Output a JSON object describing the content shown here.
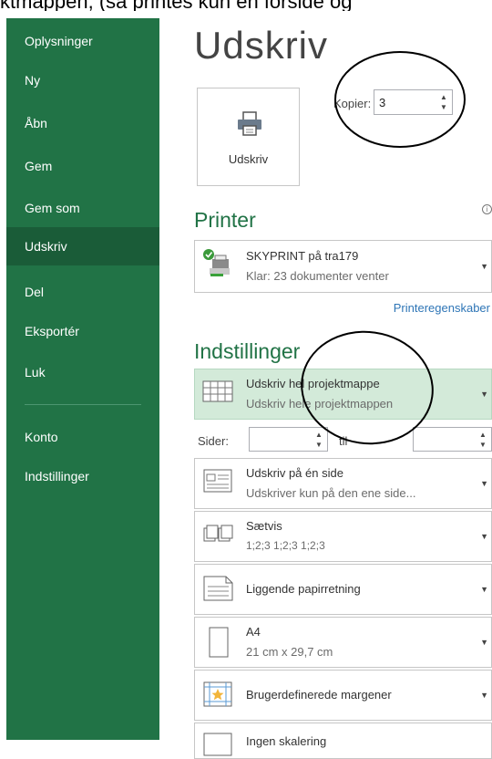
{
  "top_caption": "ktmappen, (så printes kun én forside og",
  "sidebar": {
    "items": [
      {
        "label": "Oplysninger"
      },
      {
        "label": "Ny"
      },
      {
        "label": "Åbn"
      },
      {
        "label": "Gem"
      },
      {
        "label": "Gem som"
      },
      {
        "label": "Udskriv"
      },
      {
        "label": "Del"
      },
      {
        "label": "Eksportér"
      },
      {
        "label": "Luk"
      },
      {
        "label": "Konto"
      },
      {
        "label": "Indstillinger"
      }
    ],
    "active_item": "Udskriv"
  },
  "page_title": "Udskriv",
  "print_button": {
    "label": "Udskriv"
  },
  "copies": {
    "label": "Kopier:",
    "value": "3"
  },
  "printer": {
    "heading": "Printer",
    "name": "SKYPRINT på tra179",
    "status": "Klar: 23 dokumenter venter",
    "properties_link": "Printeregenskaber"
  },
  "settings": {
    "heading": "Indstillinger",
    "scope": {
      "title": "Udskriv hel projektmappe",
      "subtitle": "Udskriv hele projektmappen"
    },
    "pages": {
      "label": "Sider:",
      "to_label": "til",
      "from_value": "",
      "to_value": ""
    },
    "sides": {
      "title": "Udskriv på én side",
      "subtitle": "Udskriver kun på den ene side..."
    },
    "collate": {
      "title": "Sætvis",
      "subtitle": "1;2;3    1;2;3    1;2;3"
    },
    "orientation": {
      "title": "Liggende papirretning"
    },
    "paper": {
      "title": "A4",
      "subtitle": "21 cm x 29,7 cm"
    },
    "margins": {
      "title": "Brugerdefinerede margener"
    },
    "scaling": {
      "title": "Ingen skalering"
    }
  },
  "colors": {
    "sidebar": "#217346",
    "accent": "#217346",
    "selected_bg": "#d3ead9",
    "link": "#2e75b6"
  }
}
